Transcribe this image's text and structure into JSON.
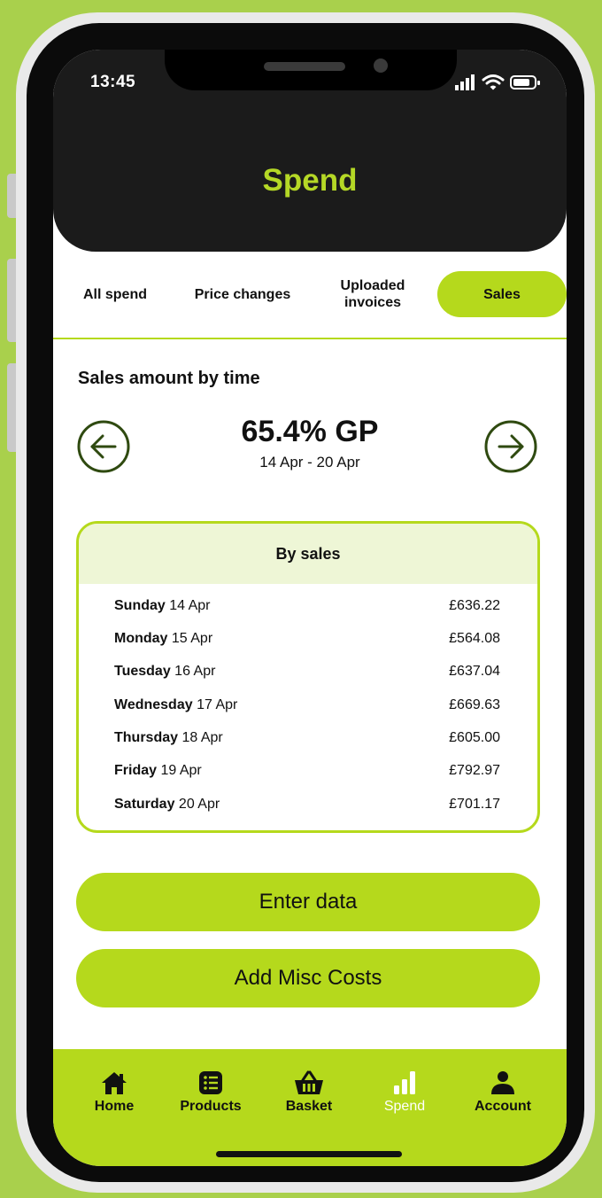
{
  "status_bar": {
    "time": "13:45",
    "icons": [
      "signal-icon",
      "wifi-icon",
      "battery-icon"
    ]
  },
  "header": {
    "title": "Spend"
  },
  "tabs": [
    {
      "label": "All spend",
      "active": false
    },
    {
      "label": "Price changes",
      "active": false
    },
    {
      "label": "Uploaded\ninvoices",
      "active": false
    },
    {
      "label": "Sales",
      "active": true
    }
  ],
  "section": {
    "title": "Sales amount by time",
    "gp_value": "65.4% GP",
    "date_range": "14 Apr - 20 Apr",
    "prev_icon": "arrow-left-circle-icon",
    "next_icon": "arrow-right-circle-icon"
  },
  "table": {
    "header": "By sales",
    "rows": [
      {
        "day": "Sunday",
        "date": "14 Apr",
        "amount": "£636.22"
      },
      {
        "day": "Monday",
        "date": "15 Apr",
        "amount": "£564.08"
      },
      {
        "day": "Tuesday",
        "date": "16 Apr",
        "amount": "£637.04"
      },
      {
        "day": "Wednesday",
        "date": "17 Apr",
        "amount": "£669.63"
      },
      {
        "day": "Thursday",
        "date": "18 Apr",
        "amount": "£605.00"
      },
      {
        "day": "Friday",
        "date": "19 Apr",
        "amount": "£792.97"
      },
      {
        "day": "Saturday",
        "date": "20 Apr",
        "amount": "£701.17"
      }
    ]
  },
  "actions": {
    "enter_data": "Enter data",
    "add_misc_costs": "Add Misc Costs"
  },
  "bottom_nav": [
    {
      "label": "Home",
      "icon": "home-icon",
      "active": false
    },
    {
      "label": "Products",
      "icon": "list-icon",
      "active": false
    },
    {
      "label": "Basket",
      "icon": "basket-icon",
      "active": false
    },
    {
      "label": "Spend",
      "icon": "bar-chart-icon",
      "active": true
    },
    {
      "label": "Account",
      "icon": "person-icon",
      "active": false
    }
  ],
  "colors": {
    "background": "#a9d04c",
    "accent": "#b5d91c",
    "header_bg": "#1b1b1b",
    "title_color": "#b5d826",
    "table_header_bg": "#eef6d6",
    "arrow_color": "#2f4a10"
  }
}
